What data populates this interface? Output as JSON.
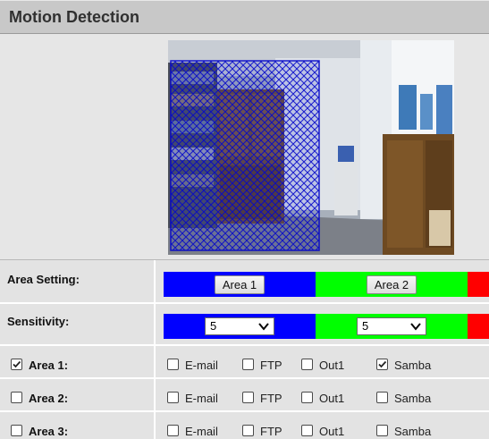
{
  "header": {
    "title": "Motion Detection"
  },
  "area_setting": {
    "label": "Area Setting:",
    "areas": [
      {
        "button_label": "Area 1",
        "color": "#0000ff"
      },
      {
        "button_label": "Area 2",
        "color": "#00ff00"
      },
      {
        "button_label": "",
        "color": "#ff0000"
      }
    ]
  },
  "sensitivity": {
    "label": "Sensitivity:",
    "values": [
      "5",
      "5"
    ]
  },
  "area_rows": [
    {
      "label": "Area 1:",
      "checked": true,
      "options": [
        {
          "label": "E-mail",
          "checked": false
        },
        {
          "label": "FTP",
          "checked": false
        },
        {
          "label": "Out1",
          "checked": false
        },
        {
          "label": "Samba",
          "checked": true
        }
      ]
    },
    {
      "label": "Area 2:",
      "checked": false,
      "options": [
        {
          "label": "E-mail",
          "checked": false
        },
        {
          "label": "FTP",
          "checked": false
        },
        {
          "label": "Out1",
          "checked": false
        },
        {
          "label": "Samba",
          "checked": false
        }
      ]
    },
    {
      "label": "Area 3:",
      "checked": false,
      "options": [
        {
          "label": "E-mail",
          "checked": false
        },
        {
          "label": "FTP",
          "checked": false
        },
        {
          "label": "Out1",
          "checked": false
        },
        {
          "label": "Samba",
          "checked": false
        }
      ]
    }
  ]
}
